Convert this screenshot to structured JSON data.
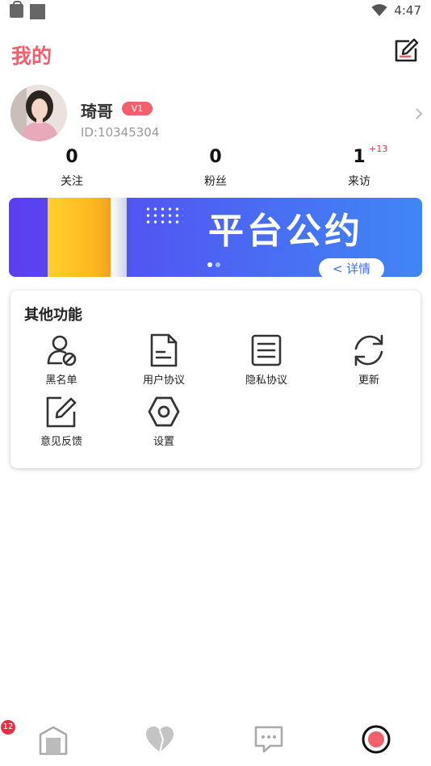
{
  "status_bar": {
    "time": "4:47"
  },
  "header": {
    "title": "我的"
  },
  "profile": {
    "username": "琦哥",
    "level": "V1",
    "user_id": "ID:10345304"
  },
  "stats": [
    {
      "count": "0",
      "label": "关注",
      "extra": ""
    },
    {
      "count": "0",
      "label": "粉丝",
      "extra": ""
    },
    {
      "count": "1",
      "label": "来访",
      "extra": "+13"
    }
  ],
  "banner": {
    "title": "平台公约",
    "details_label": "< 详情",
    "page_count": 2,
    "active_page": 1
  },
  "features": {
    "title": "其他功能",
    "items": [
      {
        "label": "黑名单",
        "icon": "blacklist-icon"
      },
      {
        "label": "用户协议",
        "icon": "document-icon"
      },
      {
        "label": "隐私协议",
        "icon": "list-document-icon"
      },
      {
        "label": "更新",
        "icon": "refresh-icon"
      },
      {
        "label": "意见反馈",
        "icon": "feedback-icon"
      },
      {
        "label": "设置",
        "icon": "settings-icon"
      }
    ]
  },
  "bottom_nav": {
    "badge": "12",
    "items": [
      {
        "icon": "home-icon"
      },
      {
        "icon": "heart-icon"
      },
      {
        "icon": "chat-icon"
      },
      {
        "icon": "profile-record-icon"
      }
    ]
  },
  "colors": {
    "accent": "#f0606d",
    "badge": "#e5304a",
    "banner_start": "#5b3ef0",
    "banner_end": "#3f86f5"
  }
}
